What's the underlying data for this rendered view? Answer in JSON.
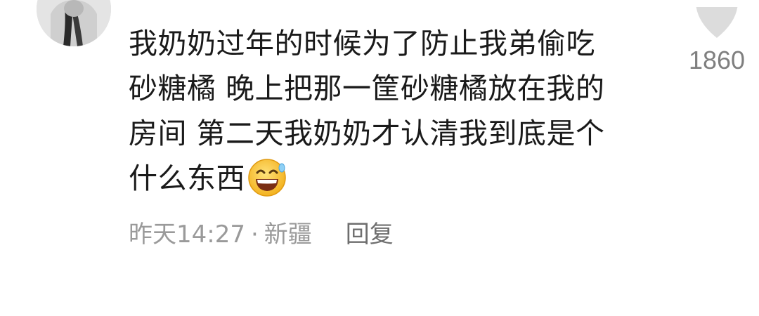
{
  "comment": {
    "lines": [
      "我奶奶过年的时候为了防止我弟偷吃",
      "砂糖橘  晚上把那一筐砂糖橘放在我的",
      "房间  第二天我奶奶才认清我到底是个",
      "什么东西"
    ],
    "emoji": "grinning-sweat-emoji",
    "time": "昨天14:27",
    "separator": "·",
    "location": "新疆",
    "reply_label": "回复"
  },
  "like": {
    "count": "1860",
    "icon": "heart-icon"
  },
  "colors": {
    "text": "#1a1a1a",
    "meta": "#9a9a9a",
    "like_icon": "#dcdcdc",
    "emoji_face": "#f7c23a"
  }
}
